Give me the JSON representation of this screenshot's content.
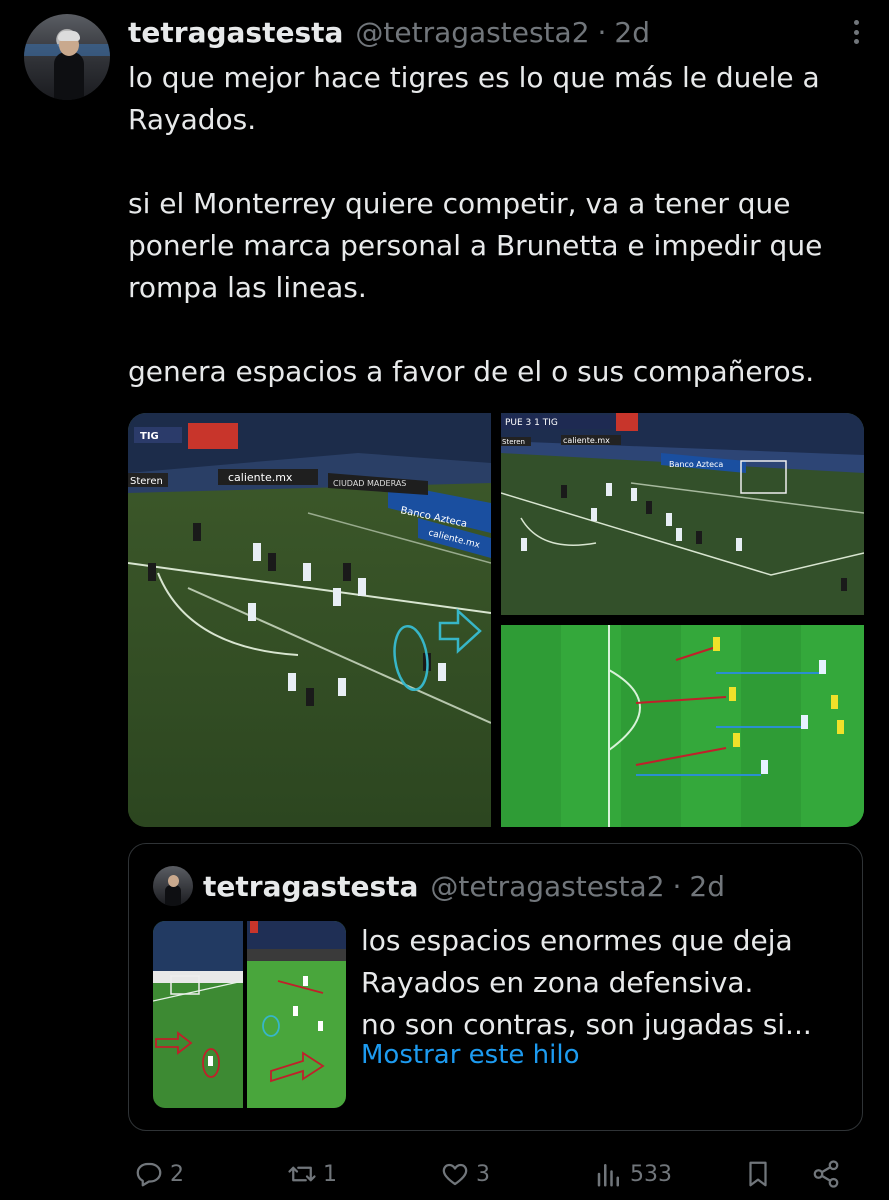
{
  "tweet": {
    "display_name": "tetragastesta",
    "handle": "@tetragastesta2",
    "separator": "·",
    "time": "2d",
    "paragraphs": [
      "lo que mejor hace tigres es lo que más le duele a Rayados.",
      "si el Monterrey quiere competir, va a tener que ponerle marca personal a Brunetta e impedir que rompa las lineas.",
      "genera espacios a favor de el o sus compañeros."
    ],
    "media": {
      "img1": {
        "scoreboard": "TIG",
        "ads": [
          "caliente.mx",
          "Banco Azteca",
          "CIUDAD MADERAS",
          "Steren",
          "caliente.mx"
        ]
      },
      "img2": {
        "scoreboard": "PUE 3 1 TIG",
        "ads": [
          "caliente.mx",
          "Banco Azteca",
          "Steren"
        ]
      }
    }
  },
  "quoted": {
    "display_name": "tetragastesta",
    "handle": "@tetragastesta2",
    "separator": "·",
    "time": "2d",
    "text_lines": [
      "los espacios enormes que deja",
      "Rayados en zona defensiva.",
      "no son contras, son jugadas si..."
    ],
    "show_thread": "Mostrar este hilo"
  },
  "actions": {
    "replies": "2",
    "retweets": "1",
    "likes": "3",
    "views": "533"
  },
  "colors": {
    "background": "#000000",
    "text": "#e7e9ea",
    "muted": "#71767b",
    "link": "#1d9bf0",
    "border": "#2f3336"
  }
}
